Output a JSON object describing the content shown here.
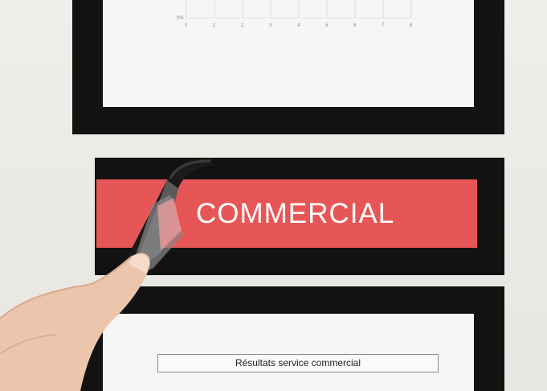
{
  "chart": {
    "ytick": "0%",
    "xticks": [
      "0",
      "1",
      "2",
      "3",
      "4",
      "5",
      "6",
      "7",
      "8"
    ]
  },
  "label": {
    "text": "COMMERCIAL",
    "color": "#e75656"
  },
  "result_title": "Résultats service commercial"
}
